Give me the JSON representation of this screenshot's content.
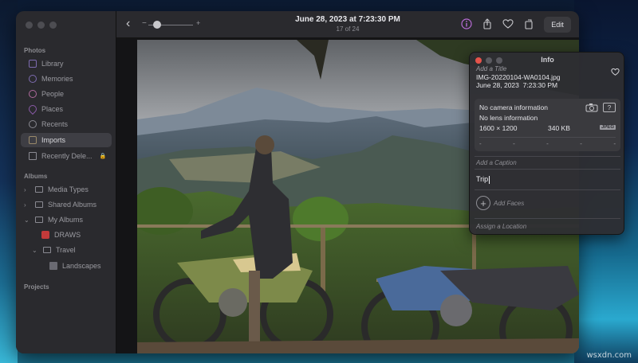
{
  "sidebar": {
    "sections": {
      "photos": "Photos",
      "albums": "Albums",
      "projects": "Projects"
    },
    "photos_items": [
      {
        "label": "Library",
        "icon": "library-icon"
      },
      {
        "label": "Memories",
        "icon": "memories-icon"
      },
      {
        "label": "People",
        "icon": "people-icon"
      },
      {
        "label": "Places",
        "icon": "places-icon"
      },
      {
        "label": "Recents",
        "icon": "recents-icon"
      },
      {
        "label": "Imports",
        "icon": "imports-icon",
        "selected": true
      },
      {
        "label": "Recently Dele...",
        "icon": "trash-icon",
        "locked": true
      }
    ],
    "albums_items": [
      {
        "label": "Media Types",
        "icon": "folder-icon",
        "disclosure": "collapsed"
      },
      {
        "label": "Shared Albums",
        "icon": "folder-icon",
        "disclosure": "collapsed"
      },
      {
        "label": "My Albums",
        "icon": "folder-icon",
        "disclosure": "expanded"
      },
      {
        "label": "DRAWS",
        "icon": "album-icon"
      },
      {
        "label": "Travel",
        "icon": "folder-icon",
        "disclosure": "expanded"
      },
      {
        "label": "Landscapes",
        "icon": "album-icon"
      }
    ]
  },
  "toolbar": {
    "title": "June 28, 2023 at 7:23:30 PM",
    "subtitle": "17 of 24",
    "edit_label": "Edit",
    "zoom_level": 0.2,
    "icons": [
      "info-icon",
      "share-icon",
      "favorite-icon",
      "rotate-icon",
      "enhance-icon"
    ],
    "accent": "#b86cd6"
  },
  "info": {
    "title": "Info",
    "add_title_placeholder": "Add a Title",
    "filename": "IMG-20220104-WA0104.jpg",
    "date": "June 28, 2023",
    "time": "7:23:30 PM",
    "camera": "No camera information",
    "lens": "No lens information",
    "resolution": "1600 × 1200",
    "filesize": "340 KB",
    "format": "JPEG",
    "exif_dashes": [
      "-",
      "-",
      "-",
      "-",
      "-"
    ],
    "caption_placeholder": "Add a Caption",
    "keywords_value": "Trip",
    "faces_label": "Add Faces",
    "faces_button": "+",
    "location_placeholder": "Assign a Location",
    "traffic_colors": [
      "#e5534b",
      "#5a5a60",
      "#5a5a60"
    ]
  },
  "watermark": "wsxdn.com"
}
